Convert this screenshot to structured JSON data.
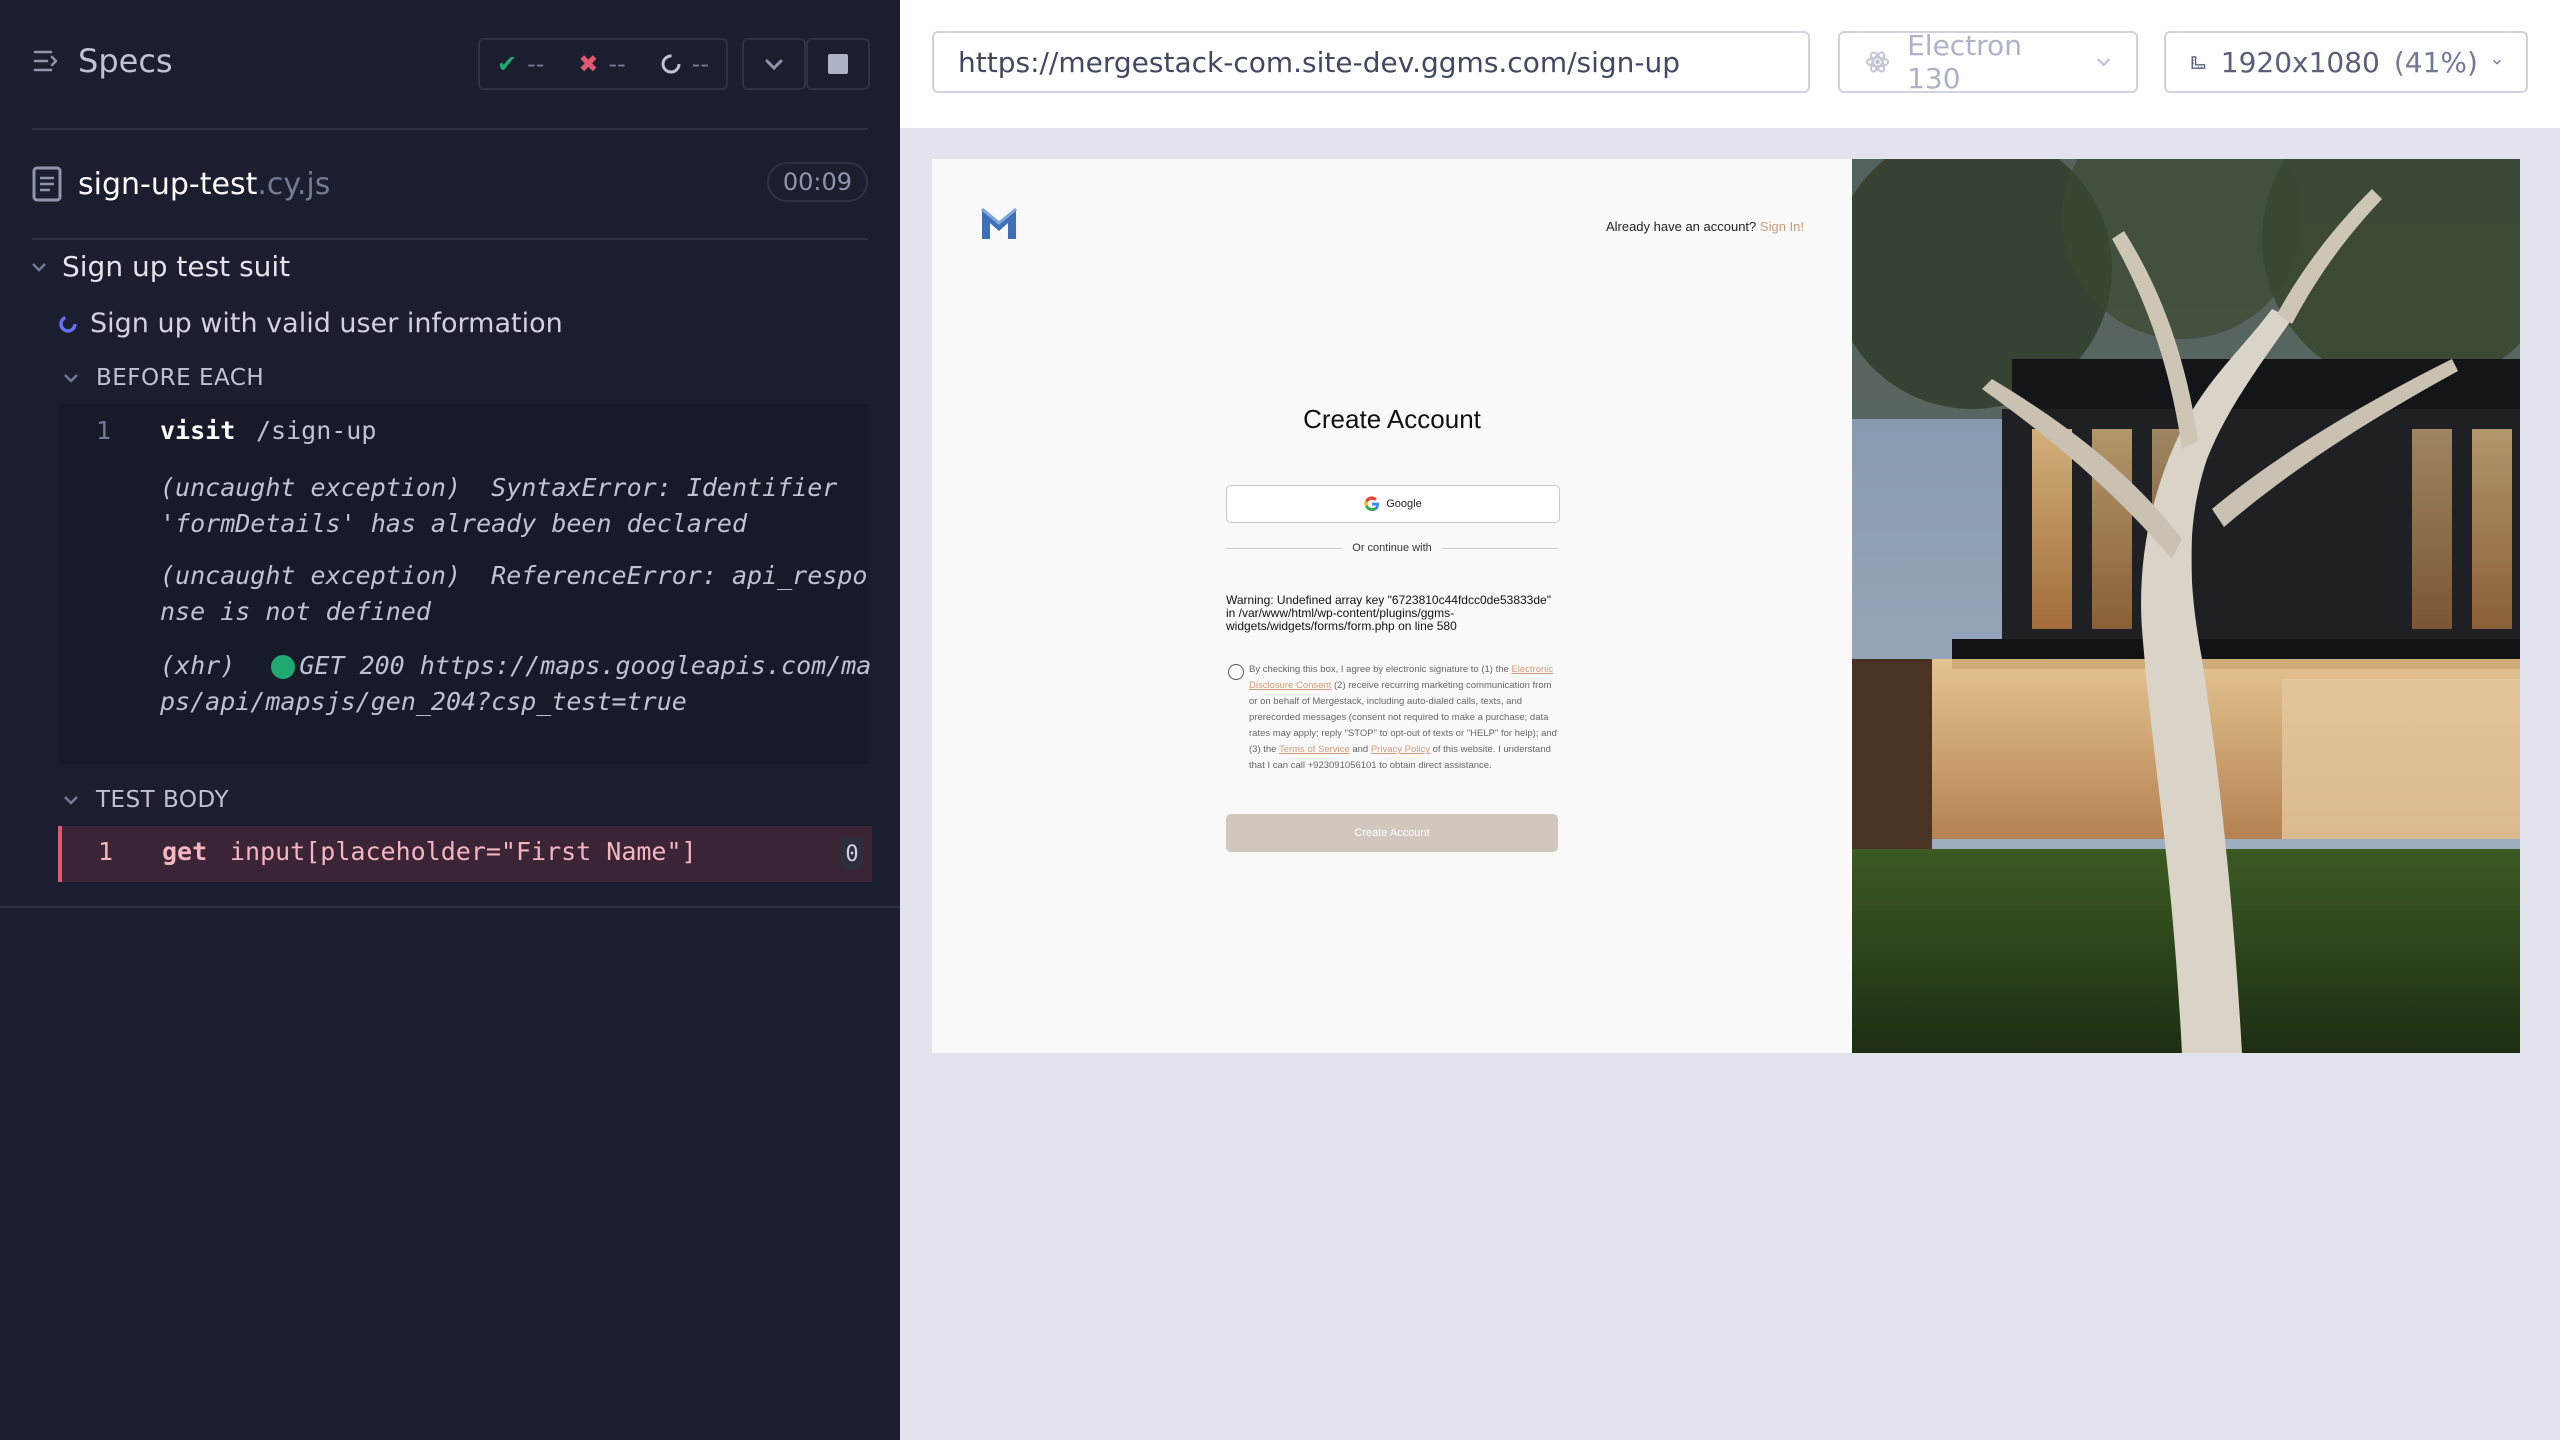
{
  "reporter": {
    "specs_label": "Specs",
    "stats": {
      "passed": "--",
      "failed": "--",
      "pending": "--"
    },
    "spec_file": {
      "name": "sign-up-test",
      "ext": ".cy.js",
      "duration": "00:09"
    },
    "suite_title": "Sign up test suit",
    "test_title": "Sign up with valid user information",
    "before_each": {
      "label": "BEFORE EACH",
      "command": {
        "num": "1",
        "name": "visit",
        "message": "/sign-up"
      },
      "logs": [
        {
          "label": "(uncaught exception)",
          "text": "SyntaxError: Identifier 'formDetails' has already been declared"
        },
        {
          "label": "(uncaught exception)",
          "text": "ReferenceError: api_response is not defined"
        },
        {
          "label": "(xhr)",
          "method": "GET 200",
          "url": "https://maps.googleapis.com/maps/api/mapsjs/gen_204?csp_test=true"
        }
      ]
    },
    "test_body": {
      "label": "TEST BODY",
      "command": {
        "num": "1",
        "name": "get",
        "message": "input[placeholder=\"First Name\"]",
        "count": "0"
      }
    }
  },
  "browser_bar": {
    "url": "https://mergestack-com.site-dev.ggms.com/sign-up",
    "browser": "Electron 130",
    "viewport": "1920x1080",
    "scale": "(41%)"
  },
  "app": {
    "already_text": "Already have an account?",
    "sign_in": "Sign In!",
    "title": "Create Account",
    "google_label": "Google",
    "divider_text": "Or continue with",
    "warning": "Warning: Undefined array key \"6723810c44fdcc0de53833de\" in /var/www/html/wp-content/plugins/ggms-widgets/widgets/forms/form.php on line 580",
    "consent": {
      "part1": "By checking this box, I agree by electronic signature to (1) the ",
      "link1": "Electronic Disclosure Consent",
      "part2": " (2) receive recurring marketing communication from or on behalf of Mergestack, including auto-dialed calls, texts, and prerecorded messages (consent not required to make a purchase; data rates may apply; reply \"STOP\" to opt-out of texts or \"HELP\" for help); and (3) the ",
      "link2": "Terms of Service",
      "part3": " and ",
      "link3": "Privacy Policy",
      "part4": " of this website. I understand that I can call +923091056101 to obtain direct assistance."
    },
    "create_button": "Create Account"
  },
  "colors": {
    "reporter_bg": "#1b1e2e",
    "pass": "#1fa971",
    "fail": "#e45770",
    "accent_link": "#d39a7a",
    "create_button": "#d2c7bd"
  }
}
